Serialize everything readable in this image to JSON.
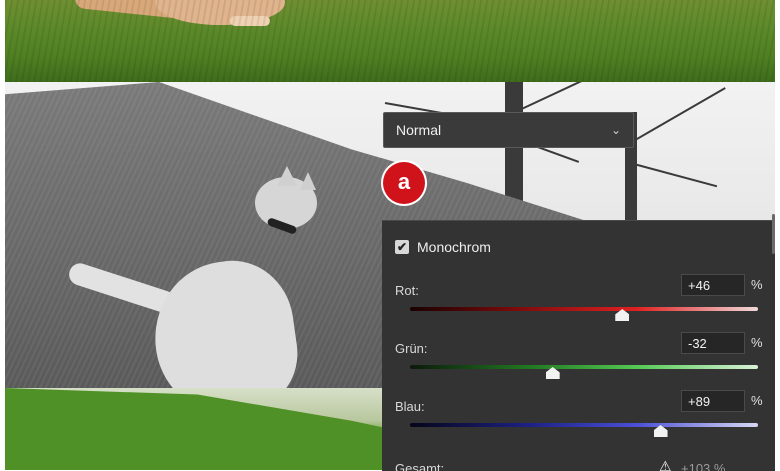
{
  "blend": {
    "mode": "Normal",
    "chevron_icon": "chevron-down-icon"
  },
  "marker": {
    "label": "a",
    "color": "#d0121b"
  },
  "panel": {
    "monochrome": {
      "label": "Monochrom",
      "checked": true,
      "check_glyph": "✔"
    },
    "channels": [
      {
        "label": "Rot:",
        "value": "+46",
        "unit": "%",
        "slider_position": 0.61,
        "color": "#e02020"
      },
      {
        "label": "Grün:",
        "value": "-32",
        "unit": "%",
        "slider_position": 0.41,
        "color": "#53c953"
      },
      {
        "label": "Blau:",
        "value": "+89",
        "unit": "%",
        "slider_position": 0.72,
        "color": "#4b4fd6"
      }
    ],
    "total": {
      "label": "Gesamt:",
      "warning_icon": "⚠",
      "value": "+103 %"
    }
  }
}
